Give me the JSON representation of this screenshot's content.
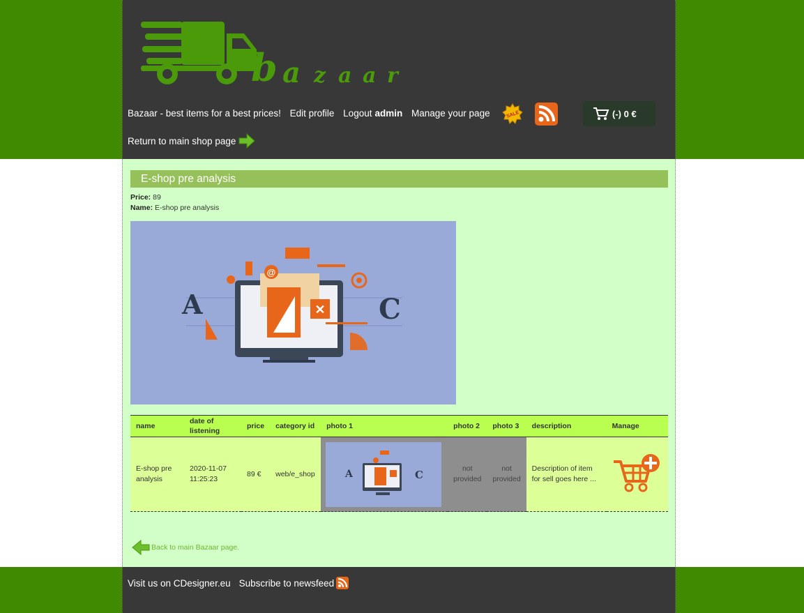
{
  "brand": {
    "logo_text": "bazaar",
    "accent": "#4a9a0a"
  },
  "nav": {
    "tagline": "Bazaar - best items for a best prices!",
    "edit_profile": "Edit profile",
    "logout_prefix": "Logout",
    "username": "admin",
    "manage_page": "Manage your page",
    "return_main": "Return to main shop page"
  },
  "cart": {
    "label": "(-) 0 €"
  },
  "product": {
    "title": "E-shop pre analysis",
    "price_label": "Price:",
    "price_value": "89",
    "name_label": "Name:",
    "name_value": "E-shop pre analysis"
  },
  "table": {
    "headers": [
      "name",
      "date of listening",
      "price",
      "category id",
      "photo 1",
      "photo 2",
      "photo 3",
      "description",
      "Manage"
    ],
    "row": {
      "name": "E-shop pre analysis",
      "date": "2020-11-07 11:25:23",
      "price": "89 €",
      "category": "web/e_shop",
      "photo2": "not provided",
      "photo3": "not provided",
      "description": "Description of item for sell goes here ..."
    }
  },
  "back_link": "Back to main Bazaar page.",
  "footer": {
    "visit": "Visit us on CDesigner.eu",
    "subscribe": "Subscribe to newsfeed"
  },
  "colors": {
    "outer": "#3f8a00",
    "header": "#383838",
    "content": "#d2ffc8",
    "title_bar": "#96c15a",
    "table_head": "#b8ff50",
    "table_row": "#dcff98"
  }
}
